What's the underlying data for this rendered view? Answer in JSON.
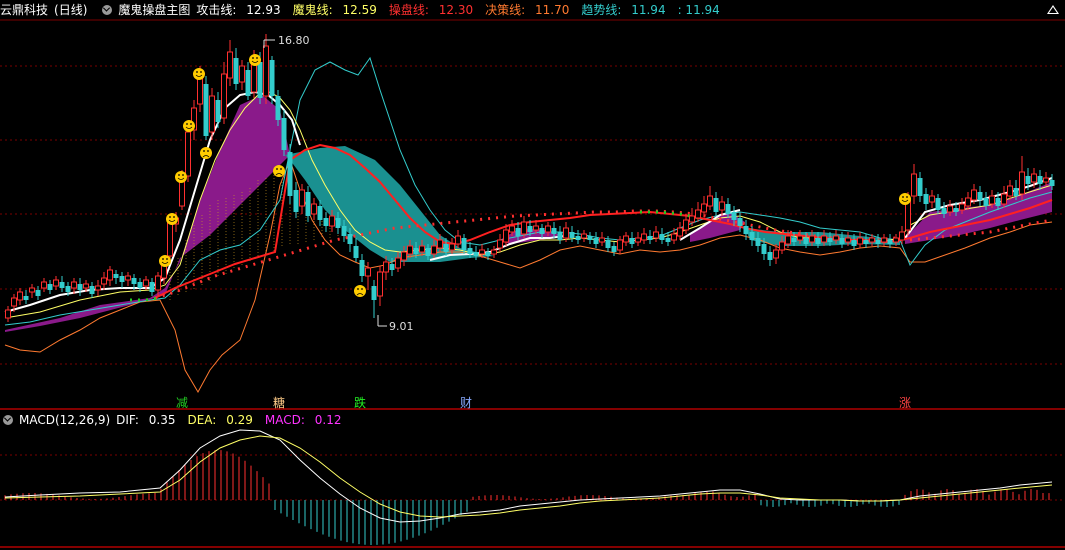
{
  "main_panel": {
    "stock_name": "云鼎科技",
    "period": "(日线)",
    "indicator_name": "魔鬼操盘主图",
    "lines": [
      {
        "label": "攻击线:",
        "value": "12.93",
        "color": "#ffffff"
      },
      {
        "label": "魔鬼线:",
        "value": "12.59",
        "color": "#ffff66"
      },
      {
        "label": "操盘线:",
        "value": "12.30",
        "color": "#ff3030"
      },
      {
        "label": "决策线:",
        "value": "11.70",
        "color": "#ff7a30"
      },
      {
        "label": "趋势线:",
        "value": "11.94",
        "color": "#33cccc"
      }
    ],
    "extra_value": ": 11.94",
    "high_marker": "16.80",
    "low_marker": "9.01",
    "signals": [
      {
        "text": "减",
        "color": "#22cc22"
      },
      {
        "text": "糖",
        "color": "#ffcc88"
      },
      {
        "text": "跌",
        "color": "#22ee22"
      },
      {
        "text": "财",
        "color": "#88aaff"
      },
      {
        "text": "涨",
        "color": "#ff4444"
      }
    ],
    "collapse_icon": "triangle-up-icon"
  },
  "macd_panel": {
    "title": "MACD(12,26,9)",
    "dif_label": "DIF:",
    "dif_value": "0.35",
    "dea_label": "DEA:",
    "dea_value": "0.29",
    "macd_label": "MACD:",
    "macd_value": "0.12",
    "icon": "circle-check-icon"
  },
  "colors": {
    "up_candle": "#ff3030",
    "down_candle": "#33cccc",
    "fill_purple": "#8a1a8a",
    "fill_teal": "#1a9090",
    "grid": "#7a0000"
  }
}
